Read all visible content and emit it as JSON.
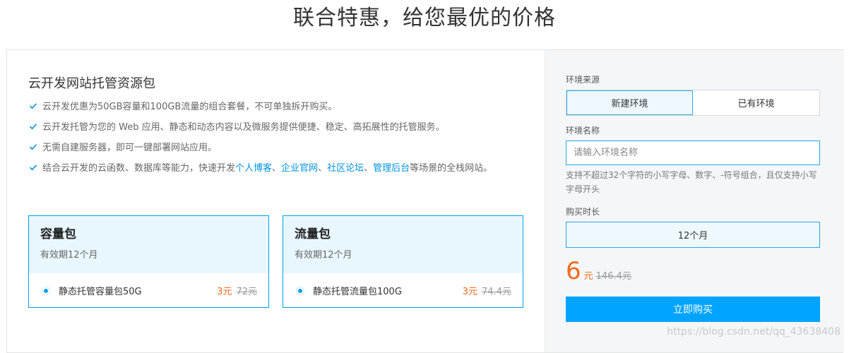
{
  "page": {
    "title": "联合特惠，给您最优的价格"
  },
  "product": {
    "title": "云开发网站托管资源包",
    "features": [
      {
        "text": "云开发优惠为50GB容量和100GB流量的组合套餐，不可单独拆开购买。"
      },
      {
        "text": "云开发托管为您的 Web 应用、静态和动态内容以及微服务提供便捷、稳定、高拓展性的托管服务。"
      },
      {
        "text": "无需自建服务器，即可一键部署网站应用。"
      },
      {
        "prefix": "结合云开发的云函数、数据库等能力，快速开发",
        "links": [
          "个人博客",
          "企业官网",
          "社区论坛",
          "管理后台"
        ],
        "separator": "、",
        "suffix": "等场景的全栈网站。"
      }
    ]
  },
  "packages": [
    {
      "name": "容量包",
      "validity": "有效期12个月",
      "item": "静态托管容量包50G",
      "price": "3元",
      "original_price": "72元"
    },
    {
      "name": "流量包",
      "validity": "有效期12个月",
      "item": "静态托管流量包100G",
      "price": "3元",
      "original_price": "74.4元"
    }
  ],
  "order": {
    "env_source_label": "环境来源",
    "env_options": [
      "新建环境",
      "已有环境"
    ],
    "env_selected": "新建环境",
    "env_name_label": "环境名称",
    "env_name_placeholder": "请输入环境名称",
    "env_name_hint": "支持不超过32个字符的小写字母、数字、-符号组合，且仅支持小写字母开头",
    "duration_label": "购买时长",
    "duration_value": "12个月",
    "total_price": "6",
    "total_unit": "元",
    "total_original": "146.4元",
    "buy_button": "立即购买"
  },
  "watermark": "https://blog.csdn.net/qq_43638408",
  "colors": {
    "accent": "#00a4ff",
    "price": "#f56b1e",
    "link": "#0093e0",
    "package_header_bg": "#e8f7fd"
  },
  "icons": {
    "feature_bullet": "check-icon"
  }
}
